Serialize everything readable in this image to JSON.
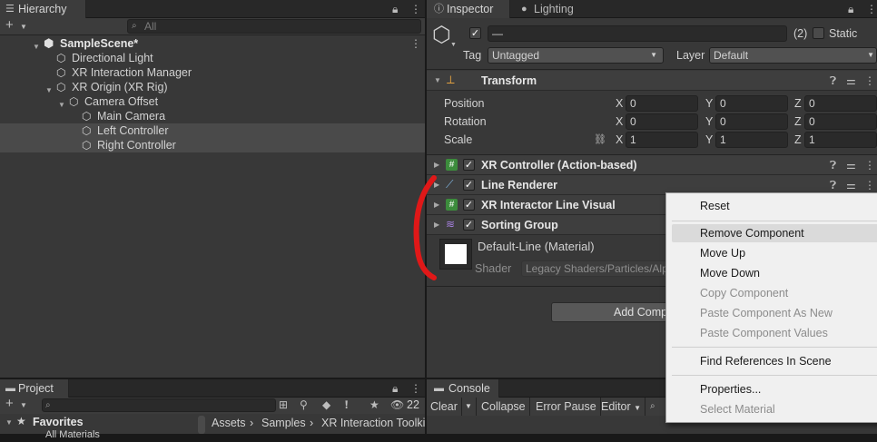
{
  "hierarchy": {
    "tab": "Hierarchy",
    "search_placeholder": "All",
    "add": "+",
    "scene": "SampleScene*",
    "items": [
      "Directional Light",
      "XR Interaction Manager",
      "XR Origin (XR Rig)",
      "Camera Offset",
      "Main Camera",
      "Left Controller",
      "Right Controller"
    ]
  },
  "inspector": {
    "tabs": [
      "Inspector",
      "Lighting"
    ],
    "name_value": "—",
    "count": "(2)",
    "static_label": "Static",
    "tag_label": "Tag",
    "tag_value": "Untagged",
    "layer_label": "Layer",
    "layer_value": "Default",
    "transform": {
      "title": "Transform",
      "rows": [
        {
          "label": "Position",
          "x": "0",
          "y": "0",
          "z": "0"
        },
        {
          "label": "Rotation",
          "x": "0",
          "y": "0",
          "z": "0"
        },
        {
          "label": "Scale",
          "x": "1",
          "y": "1",
          "z": "1"
        }
      ],
      "axes": [
        "X",
        "Y",
        "Z"
      ]
    },
    "components": [
      "XR Controller (Action-based)",
      "Line Renderer",
      "XR Interactor Line Visual",
      "Sorting Group"
    ],
    "material": {
      "name": "Default-Line (Material)",
      "shader_label": "Shader",
      "shader_value": "Legacy Shaders/Particles/Alpha Blended"
    },
    "add_component": "Add Component"
  },
  "context_menu": {
    "items": [
      {
        "label": "Reset",
        "enabled": true
      },
      {
        "label": "Remove Component",
        "enabled": true,
        "highlighted": true
      },
      {
        "label": "Move Up",
        "enabled": true
      },
      {
        "label": "Move Down",
        "enabled": true
      },
      {
        "label": "Copy Component",
        "enabled": false
      },
      {
        "label": "Paste Component As New",
        "enabled": false
      },
      {
        "label": "Paste Component Values",
        "enabled": false
      },
      {
        "label": "Find References In Scene",
        "enabled": true
      },
      {
        "label": "Properties...",
        "enabled": true
      },
      {
        "label": "Select Material",
        "enabled": false
      }
    ]
  },
  "project": {
    "tab": "Project",
    "add": "+",
    "hidden_count": "22",
    "favorites": "Favorites",
    "favorites_item": "All Materials",
    "breadcrumb": [
      "Assets",
      "Samples",
      "XR Interaction Toolkit"
    ]
  },
  "console": {
    "tab": "Console",
    "buttons": [
      "Clear",
      "Collapse",
      "Error Pause",
      "Editor"
    ]
  },
  "colors": {
    "annotation": "#e01818",
    "highlight": "#dadada",
    "panel": "#383838"
  }
}
